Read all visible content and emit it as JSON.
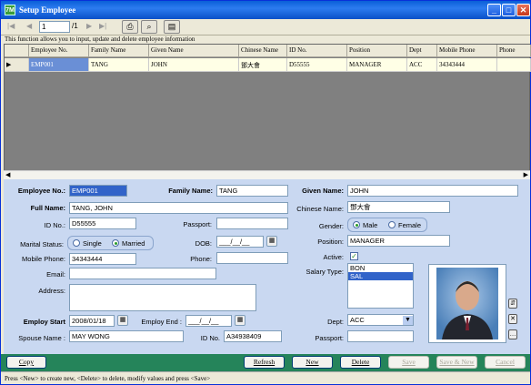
{
  "window": {
    "title": "Setup Employee"
  },
  "toolbar": {
    "record_value": "1",
    "record_total": "/1"
  },
  "info_text": "This function allows you to input, update and delete employee information",
  "grid": {
    "columns": [
      "Employee No.",
      "Family Name",
      "Given Name",
      "Chinese Name",
      "ID No.",
      "Position",
      "Dept",
      "Mobile Phone",
      "Phone"
    ],
    "row": [
      "EMP001",
      "TANG",
      "JOHN",
      "鄧大會",
      "D55555",
      "MANAGER",
      "ACC",
      "34343444",
      ""
    ]
  },
  "form": {
    "employee_no_label": "Employee No.:",
    "employee_no": "EMP001",
    "family_name_label": "Family Name:",
    "family_name": "TANG",
    "given_name_label": "Given Name:",
    "given_name": "JOHN",
    "full_name_label": "Full Name:",
    "full_name": "TANG, JOHN",
    "chinese_name_label": "Chinese Name:",
    "chinese_name": "鄧大會",
    "id_no_label": "ID No.:",
    "id_no": "D55555",
    "passport_label": "Passport:",
    "passport": "",
    "gender_label": "Gender:",
    "gender_male": "Male",
    "gender_female": "Female",
    "marital_label": "Marital Status:",
    "marital_single": "Single",
    "marital_married": "Married",
    "dob_label": "DOB:",
    "dob": "___/__/__",
    "position_label": "Position:",
    "position": "MANAGER",
    "mobile_label": "Mobile Phone:",
    "mobile": "34343444",
    "phone_label": "Phone:",
    "phone": "",
    "active_label": "Active:",
    "email_label": "Email:",
    "email": "",
    "salary_label": "Salary Type:",
    "salary_options": [
      "BON",
      "SAL"
    ],
    "address_label": "Address:",
    "address": "",
    "employ_start_label": "Employ Start",
    "employ_start": "2008/01/18",
    "employ_end_label": "Employ End :",
    "employ_end": "___/__/__",
    "dept_label": "Dept:",
    "dept": "ACC",
    "spouse_label": "Spouse Name :",
    "spouse": "MAY WONG",
    "spouse_id_label": "ID No.",
    "spouse_id": "A34938409",
    "spouse_passport_label": "Passport:",
    "spouse_passport": ""
  },
  "buttons": {
    "copy": "Copy",
    "refresh": "Refresh",
    "new": "New",
    "delete": "Delete",
    "save": "Save",
    "save_new": "Save & New",
    "cancel": "Cancel"
  },
  "status_text": "Press <New> to create new, <Delete> to delete, modify values and press <Save>"
}
